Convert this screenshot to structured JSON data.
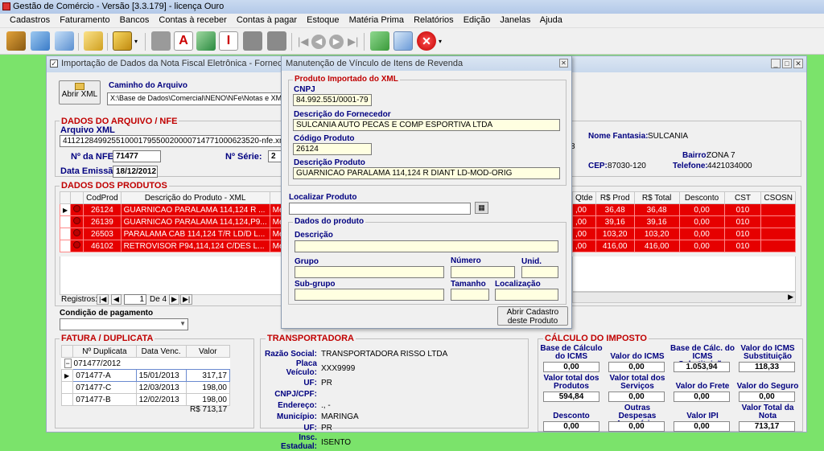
{
  "app": {
    "title": "Gestão de Comércio - Versão [3.3.179] - licença Ouro"
  },
  "menu": [
    "Cadastros",
    "Faturamento",
    "Bancos",
    "Contas à receber",
    "Contas à pagar",
    "Estoque",
    "Matéria Prima",
    "Relatórios",
    "Edição",
    "Janelas",
    "Ajuda"
  ],
  "main": {
    "title": "Importação de Dados da Nota Fiscal Eletrônica - Fornecedor",
    "abrir_xml": "Abrir XML",
    "caminho_label": "Caminho do Arquivo",
    "caminho_value": "X:\\Base de Dados\\Comercial\\NENO\\NFe\\Notas e XML rece",
    "dados_arquivo": "DADOS DO ARQUIVO / NFE",
    "arquivo_xml_label": "Arquivo XML",
    "arquivo_xml_value": "41121284992551000179550020000714771000623520-nfe.xml",
    "nfe_label": "Nº da NFE:",
    "nfe_value": "71477",
    "serie_label": "Nº Série:",
    "serie_value": "2",
    "emissao_label": "Data Emissão:",
    "emissao_value": "18/12/2012",
    "fantasia_label": "Nome Fantasia:",
    "fantasia_value": "SULCANIA",
    "bairro_label": "Bairro:",
    "bairro_value": "ZONA 7",
    "cep_label": "CEP:",
    "cep_value": "87030-120",
    "telefone_label": "Telefone:",
    "telefone_value": "4421034000",
    "partial_8": "8"
  },
  "produtos": {
    "header": "DADOS DOS PRODUTOS",
    "cols": [
      "CodProd",
      "Descrição do Produto - XML",
      "Tip"
    ],
    "right_cols": [
      "Qtde",
      "R$ Prod",
      "R$ Total",
      "Desconto",
      "CST",
      "CSOSN"
    ],
    "rows": [
      {
        "cod": "26124",
        "desc": "GUARNICAO PARALAMA 114,124 R ...",
        "tip": "Mercador",
        "qtde": ",00",
        "prod": "36,48",
        "total": "36,48",
        "desc_v": "0,00",
        "cst": "010"
      },
      {
        "cod": "26139",
        "desc": "GUARNICAO PARALAMA 114,124,P9...",
        "tip": "Mercador",
        "qtde": ",00",
        "prod": "39,16",
        "total": "39,16",
        "desc_v": "0,00",
        "cst": "010"
      },
      {
        "cod": "26503",
        "desc": "PARALAMA CAB 114,124 T/R LD/D L...",
        "tip": "Mercador",
        "qtde": ",00",
        "prod": "103,20",
        "total": "103,20",
        "desc_v": "0,00",
        "cst": "010"
      },
      {
        "cod": "46102",
        "desc": "RETROVISOR P94,114,124 C/DES L...",
        "tip": "Mercador",
        "qtde": ",00",
        "prod": "416,00",
        "total": "416,00",
        "desc_v": "0,00",
        "cst": "010"
      }
    ],
    "registros_label": "Registros:",
    "registros_value": "1",
    "de_label": "De 4"
  },
  "pagamento": {
    "label": "Condição de pagamento"
  },
  "fatura": {
    "header": "FATURA / DUPLICATA",
    "cols": [
      "Nº Duplicata",
      "Data Venc.",
      "Valor"
    ],
    "group": "071477/2012",
    "rows": [
      {
        "dup": "071477-A",
        "venc": "15/01/2013",
        "valor": "317,17"
      },
      {
        "dup": "071477-C",
        "venc": "12/03/2013",
        "valor": "198,00"
      },
      {
        "dup": "071477-B",
        "venc": "12/02/2013",
        "valor": "198,00"
      }
    ],
    "total": "R$ 713,17"
  },
  "transp": {
    "header": "TRANSPORTADORA",
    "fields": [
      {
        "label": "Razão Social:",
        "value": "TRANSPORTADORA RISSO LTDA"
      },
      {
        "label": "Placa Veículo:",
        "value": "XXX9999"
      },
      {
        "label": "UF:",
        "value": "PR"
      },
      {
        "label": "CNPJ/CPF:",
        "value": ""
      },
      {
        "label": "Endereço:",
        "value": "., -"
      },
      {
        "label": "Município:",
        "value": "MARINGA"
      },
      {
        "label": "UF:",
        "value": "PR"
      },
      {
        "label": "Insc. Estadual:",
        "value": "ISENTO"
      }
    ]
  },
  "imposto": {
    "header": "CÁLCULO DO IMPOSTO",
    "r1": [
      {
        "l": "Base de Cálculo do ICMS",
        "v": "0,00"
      },
      {
        "l": "Valor do ICMS",
        "v": "0,00"
      },
      {
        "l": "Base de Cálc. do ICMS Substituição",
        "v": "1.053,94"
      },
      {
        "l": "Valor do ICMS Substituição",
        "v": "118,33"
      }
    ],
    "r2": [
      {
        "l": "Valor total dos Produtos",
        "v": "594,84"
      },
      {
        "l": "Valor total dos Serviços",
        "v": "0,00"
      },
      {
        "l": "Valor do Frete",
        "v": "0,00"
      },
      {
        "l": "Valor do Seguro",
        "v": "0,00"
      }
    ],
    "r3": [
      {
        "l": "Desconto",
        "v": "0,00"
      },
      {
        "l": "Outras Despesas Acessórias",
        "v": "0,00"
      },
      {
        "l": "Valor IPI",
        "v": "0,00"
      },
      {
        "l": "Valor Total da Nota",
        "v": "713,17"
      }
    ]
  },
  "dialog": {
    "title": "Manutenção de Vínculo de Itens de Revenda",
    "imported_header": "Produto Importado do XML",
    "cnpj_label": "CNPJ",
    "cnpj_value": "84.992.551/0001-79",
    "fornecedor_label": "Descrição do Fornecedor",
    "fornecedor_value": "SULCANIA AUTO PECAS E COMP ESPORTIVA LTDA",
    "codigo_label": "Código Produto",
    "codigo_value": "26124",
    "descprod_label": "Descrição Produto",
    "descprod_value": "GUARNICAO PARALAMA 114,124 R DIANT LD-MOD-ORIG",
    "localizar_label": "Localizar Produto",
    "dados_label": "Dados do produto",
    "descricao_label": "Descrição",
    "grupo_label": "Grupo",
    "numero_label": "Número",
    "unid_label": "Unid.",
    "subgrupo_label": "Sub-grupo",
    "tamanho_label": "Tamanho",
    "localizacao_label": "Localização",
    "abrir_cadastro": "Abrir Cadastro deste Produto"
  }
}
